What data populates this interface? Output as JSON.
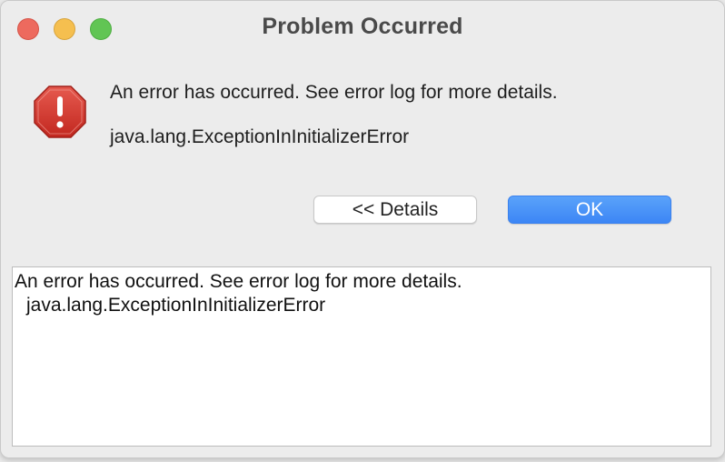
{
  "window": {
    "title": "Problem Occurred"
  },
  "traffic_lights": {
    "close_color": "#ed6a5e",
    "minimize_color": "#f5bf4f",
    "zoom_color": "#61c554"
  },
  "dialog": {
    "icon": "error-stop-icon",
    "icon_color": "#d2362f",
    "message": "An error has occurred. See error log for more details.",
    "exception": "java.lang.ExceptionInInitializerError"
  },
  "buttons": {
    "details_label": "<< Details",
    "ok_label": "OK",
    "ok_color": "#3c86f5"
  },
  "details": {
    "lines": [
      "An error has occurred. See error log for more details.",
      "java.lang.ExceptionInInitializerError"
    ]
  }
}
